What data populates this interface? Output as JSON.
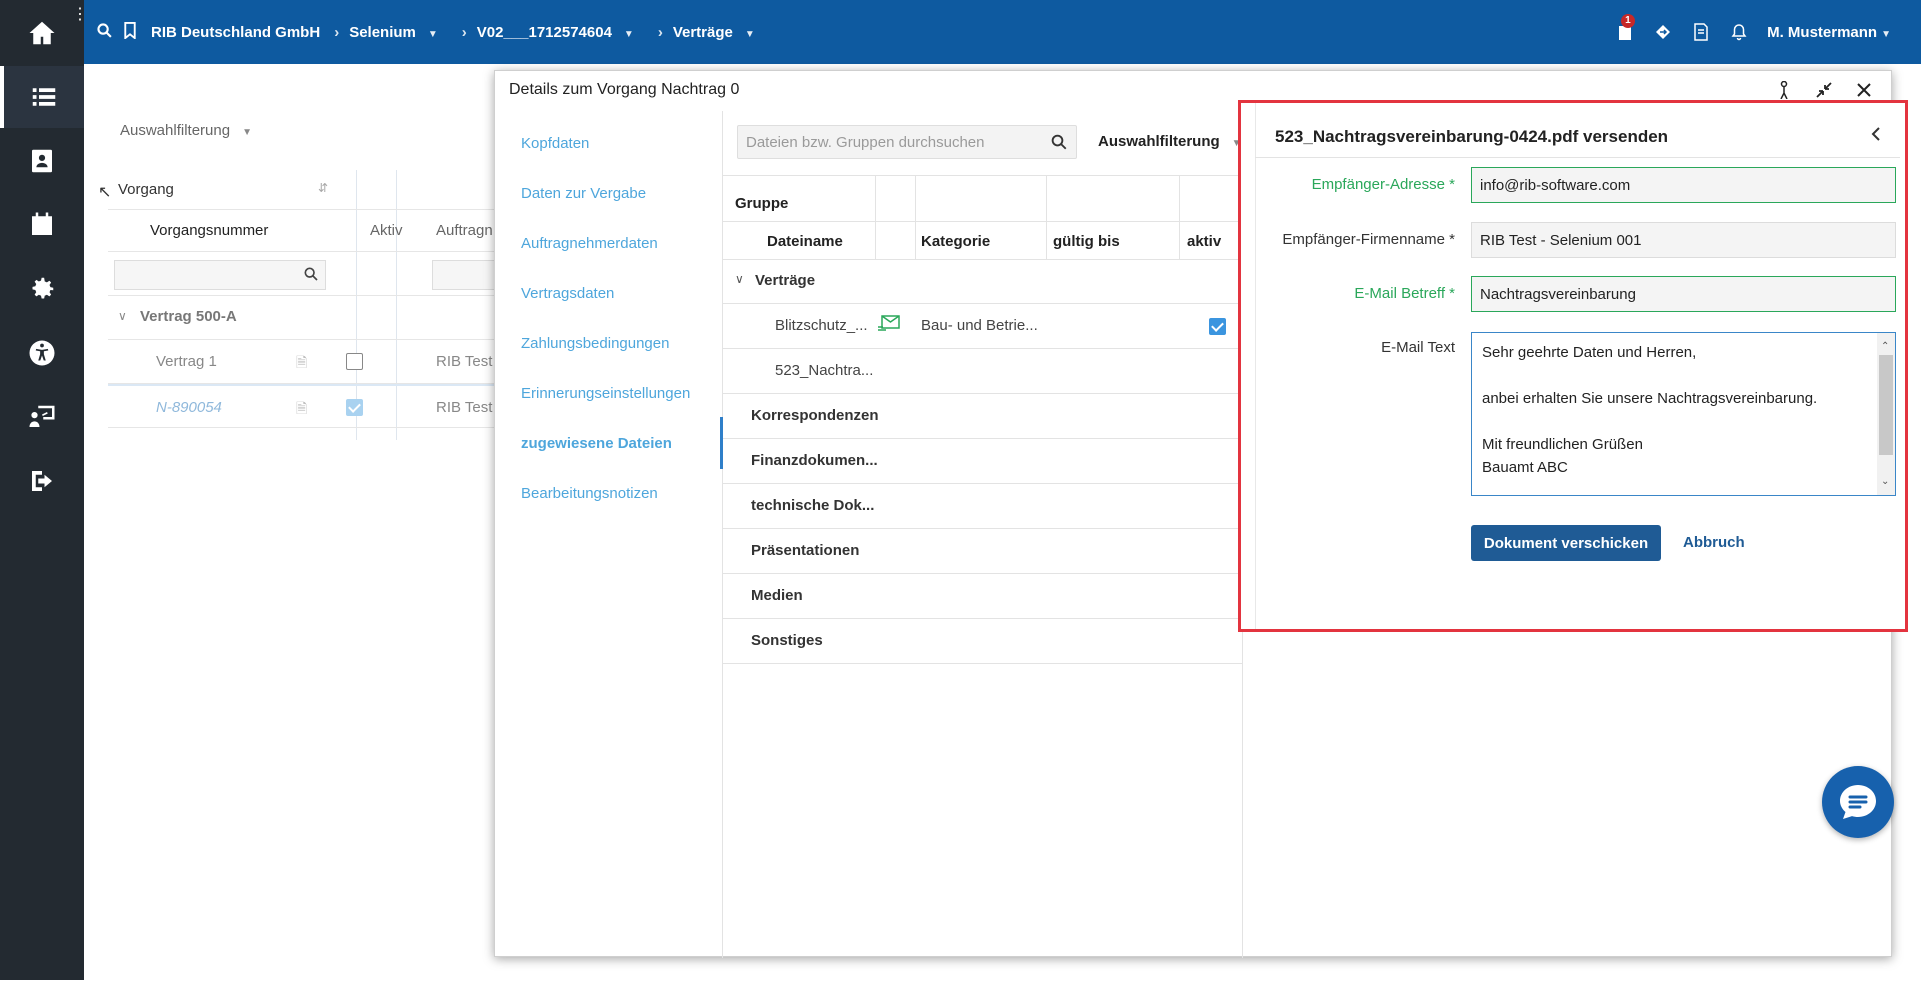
{
  "topbar": {
    "company": "RIB Deutschland GmbH",
    "project": "Selenium",
    "version": "V02___1712574604",
    "module": "Verträge",
    "notification_count": "1",
    "user": "M. Mustermann"
  },
  "background": {
    "filter_label": "Auswahlfilterung",
    "group_header": "Vorgang",
    "col_vorgangsnummer": "Vorgangsnummer",
    "col_aktiv": "Aktiv",
    "col_auftrag": "Auftragn",
    "group_row": "Vertrag 500-A",
    "rows": [
      {
        "name": "Vertrag 1",
        "auftrag": "RIB Test"
      },
      {
        "name": "N-890054",
        "auftrag": "RIB Test"
      }
    ]
  },
  "dialog": {
    "title": "Details zum Vorgang Nachtrag 0",
    "nav": [
      "Kopfdaten",
      "Daten zur Vergabe",
      "Auftragnehmerdaten",
      "Vertragsdaten",
      "Zahlungsbedingungen",
      "Erinnerungseinstellungen",
      "zugewiesene Dateien",
      "Bearbeitungsnotizen"
    ],
    "files": {
      "search_placeholder": "Dateien bzw. Gruppen durchsuchen",
      "filter_label": "Auswahlfilterung",
      "col_gruppe": "Gruppe",
      "col_dateiname": "Dateiname",
      "col_kategorie": "Kategorie",
      "col_gueltig": "gültig bis",
      "col_aktiv": "aktiv",
      "group_vertraege": "Verträge",
      "file1_name": "Blitzschutz_...",
      "file1_category": "Bau- und Betrie...",
      "file2_name": "523_Nachtra...",
      "groups": [
        "Korrespondenzen",
        "Finanzdokumen...",
        "technische Dok...",
        "Präsentationen",
        "Medien",
        "Sonstiges"
      ]
    },
    "send": {
      "title": "523_Nachtragsvereinbarung-0424.pdf versenden",
      "label_address": "Empfänger-Adresse *",
      "value_address": "info@rib-software.com",
      "label_company": "Empfänger-Firmenname *",
      "value_company": "RIB Test - Selenium 001",
      "label_subject": "E-Mail Betreff *",
      "value_subject": "Nachtragsvereinbarung",
      "label_text": "E-Mail Text",
      "text_line1": "Sehr geehrte Daten und Herren,",
      "text_line2": "anbei erhalten Sie unsere Nachtragsvereinbarung.",
      "text_line3": "Mit freundlichen Grüßen",
      "text_line4": "Bauamt ABC",
      "send_button": "Dokument verschicken",
      "cancel_button": "Abbruch"
    }
  },
  "colors": {
    "topbar": "#0e5aa0",
    "rail": "#232a31",
    "required_label": "#2aa75a",
    "highlight_border": "#e3343f",
    "primary_button": "#1f5b95",
    "nav_link": "#4ea6dc"
  }
}
